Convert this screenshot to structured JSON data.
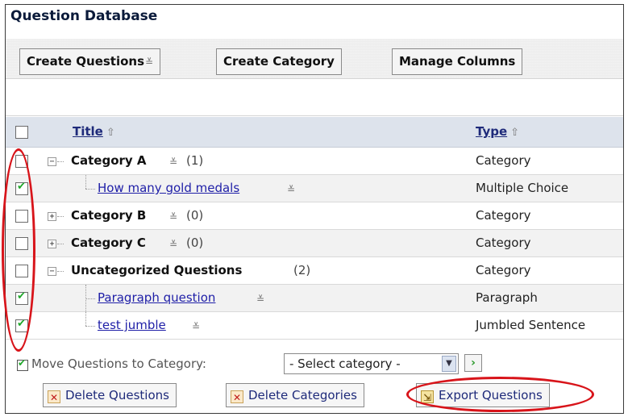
{
  "title": "Question Database",
  "toolbar": {
    "create_questions": "Create Questions",
    "create_category": "Create Category",
    "manage_columns": "Manage Columns"
  },
  "columns": {
    "title": "Title",
    "type": "Type"
  },
  "rows": [
    {
      "kind": "category",
      "name": "Category A",
      "count": "(1)",
      "type": "Category",
      "checked": false,
      "expanded": true
    },
    {
      "kind": "question",
      "name": "How many gold medals",
      "type": "Multiple Choice",
      "checked": true
    },
    {
      "kind": "category",
      "name": "Category B",
      "count": "(0)",
      "type": "Category",
      "checked": false,
      "expanded": false
    },
    {
      "kind": "category",
      "name": "Category C",
      "count": "(0)",
      "type": "Category",
      "checked": false,
      "expanded": false
    },
    {
      "kind": "category",
      "name": "Uncategorized Questions",
      "count": "(2)",
      "type": "Category",
      "checked": false,
      "expanded": true
    },
    {
      "kind": "question",
      "name": "Paragraph question",
      "type": "Paragraph",
      "checked": true
    },
    {
      "kind": "question",
      "name": "test jumble",
      "type": "Jumbled Sentence",
      "checked": true
    }
  ],
  "move": {
    "label": "Move Questions to Category:",
    "select_value": "- Select category -"
  },
  "actions": {
    "delete_questions": "Delete Questions",
    "delete_categories": "Delete Categories",
    "export_questions": "Export Questions"
  },
  "colors": {
    "annotation": "#d8141a",
    "link": "#2020a8",
    "check": "#1fa82a"
  },
  "icons": {
    "menu": "menu-lines-icon",
    "sort": "sort-up-arrow-icon",
    "collapse": "minus-box-icon",
    "expand": "plus-box-icon",
    "delete": "delete-x-icon",
    "export": "export-icon",
    "go": "go-arrow-icon"
  }
}
